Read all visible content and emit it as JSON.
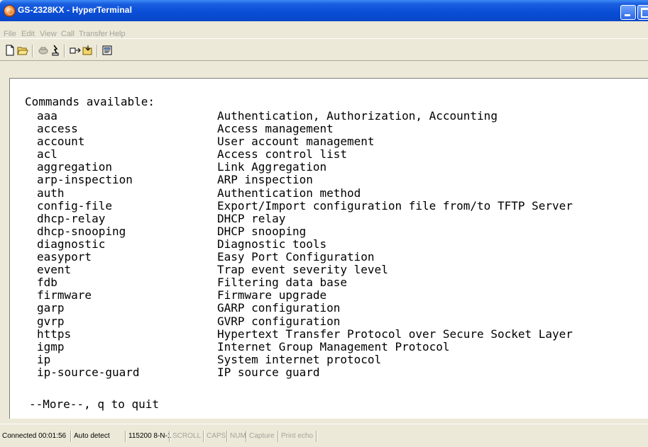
{
  "window": {
    "title": "GS-2328KX - HyperTerminal"
  },
  "menu": {
    "items": [
      "File",
      "Edit",
      "View",
      "Call",
      "Transfer",
      "Help"
    ]
  },
  "toolbar": {
    "buttons": [
      "new-connection-icon",
      "open-icon",
      "disconnect-icon",
      "dial-icon",
      "send-icon",
      "receive-icon",
      "properties-icon"
    ]
  },
  "terminal": {
    "header": "Commands available:",
    "commands": [
      {
        "name": "aaa",
        "description": "Authentication, Authorization, Accounting"
      },
      {
        "name": "access",
        "description": "Access management"
      },
      {
        "name": "account",
        "description": "User account management"
      },
      {
        "name": "acl",
        "description": "Access control list"
      },
      {
        "name": "aggregation",
        "description": "Link Aggregation"
      },
      {
        "name": "arp-inspection",
        "description": "ARP inspection"
      },
      {
        "name": "auth",
        "description": "Authentication method"
      },
      {
        "name": "config-file",
        "description": "Export/Import configuration file from/to TFTP Server"
      },
      {
        "name": "dhcp-relay",
        "description": "DHCP relay"
      },
      {
        "name": "dhcp-snooping",
        "description": "DHCP snooping"
      },
      {
        "name": "diagnostic",
        "description": "Diagnostic tools"
      },
      {
        "name": "easyport",
        "description": "Easy Port Configuration"
      },
      {
        "name": "event",
        "description": "Trap event severity level"
      },
      {
        "name": "fdb",
        "description": "Filtering data base"
      },
      {
        "name": "firmware",
        "description": "Firmware upgrade"
      },
      {
        "name": "garp",
        "description": "GARP configuration"
      },
      {
        "name": "gvrp",
        "description": "GVRP configuration"
      },
      {
        "name": "https",
        "description": "Hypertext Transfer Protocol over Secure Socket Layer"
      },
      {
        "name": "igmp",
        "description": "Internet Group Management Protocol"
      },
      {
        "name": "ip",
        "description": "System internet protocol"
      },
      {
        "name": "ip-source-guard",
        "description": "IP source guard"
      }
    ],
    "more_prompt": "--More--, q to quit"
  },
  "status": {
    "connected": "Connected 00:01:56",
    "detect": "Auto detect",
    "settings": "115200 8-N-1",
    "scroll": "SCROLL",
    "caps": "CAPS",
    "num": "NUM",
    "capture": "Capture",
    "print_echo": "Print echo"
  },
  "colors": {
    "titlebar": "#0a4ed6",
    "chrome": "#ece9d8",
    "terminal_bg": "#ffffff",
    "terminal_text": "#000000",
    "disabled_text": "#a5a39a"
  }
}
